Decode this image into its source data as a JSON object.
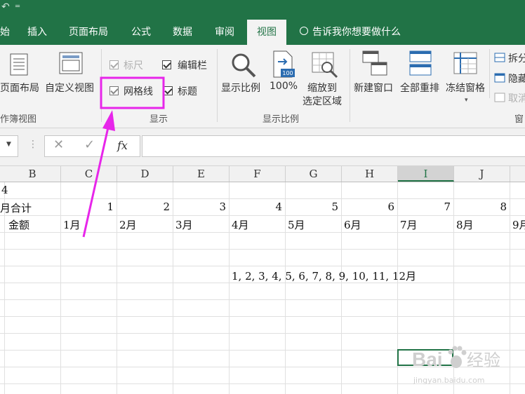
{
  "titlebar": {
    "undo_glyph": "↶",
    "qat_more_glyph": "═"
  },
  "tabs": [
    {
      "label": "始"
    },
    {
      "label": "插入"
    },
    {
      "label": "页面布局"
    },
    {
      "label": "公式"
    },
    {
      "label": "数据"
    },
    {
      "label": "审阅"
    },
    {
      "label": "视图",
      "active": true
    }
  ],
  "tell_me": "告诉我你想要做什么",
  "ribbon": {
    "workbook_views": {
      "page_layout": "页面布局",
      "custom_views": "自定义视图",
      "group_label": "作簿视图"
    },
    "show": {
      "ruler": "标尺",
      "formula_bar": "编辑栏",
      "gridlines": "网格线",
      "headings": "标题",
      "group_label": "显示"
    },
    "zoom": {
      "zoom": "显示比例",
      "hundred": "100%",
      "hundred_badge": "100",
      "zoom_to_selection_line1": "缩放到",
      "zoom_to_selection_line2": "选定区域",
      "group_label": "显示比例"
    },
    "window": {
      "new_window": "新建窗口",
      "arrange_all": "全部重排",
      "freeze_panes": "冻结窗格",
      "split": "拆分",
      "hide": "隐藏",
      "unhide": "取消",
      "group_label": "窗"
    }
  },
  "formula_bar": {
    "cancel_glyph": "✕",
    "enter_glyph": "✓",
    "fx": "fx",
    "value": ""
  },
  "columns": [
    "B",
    "C",
    "D",
    "E",
    "F",
    "G",
    "H",
    "I",
    "J"
  ],
  "selected_column": "I",
  "rows": {
    "r1": {
      "A": "4"
    },
    "r2": {
      "A": "月合计",
      "C": "1",
      "D": "2",
      "E": "3",
      "F": "4",
      "G": "5",
      "H": "6",
      "I": "7",
      "J": "8"
    },
    "r3": {
      "B": "金额",
      "C": "1月",
      "D": "2月",
      "E": "3月",
      "F": "4月",
      "G": "5月",
      "H": "6月",
      "I": "7月",
      "J": "8月",
      "K": "9月"
    },
    "r6": {
      "F": "1, 2, 3, 4, 5, 6, 7, 8, 9, 10, 11, 12月"
    }
  },
  "watermark": {
    "brand": "Bai",
    "brand2": "经验",
    "url": "jingyan.baidu.com"
  },
  "colors": {
    "excel_green": "#217346",
    "annotation": "#e726ea"
  }
}
